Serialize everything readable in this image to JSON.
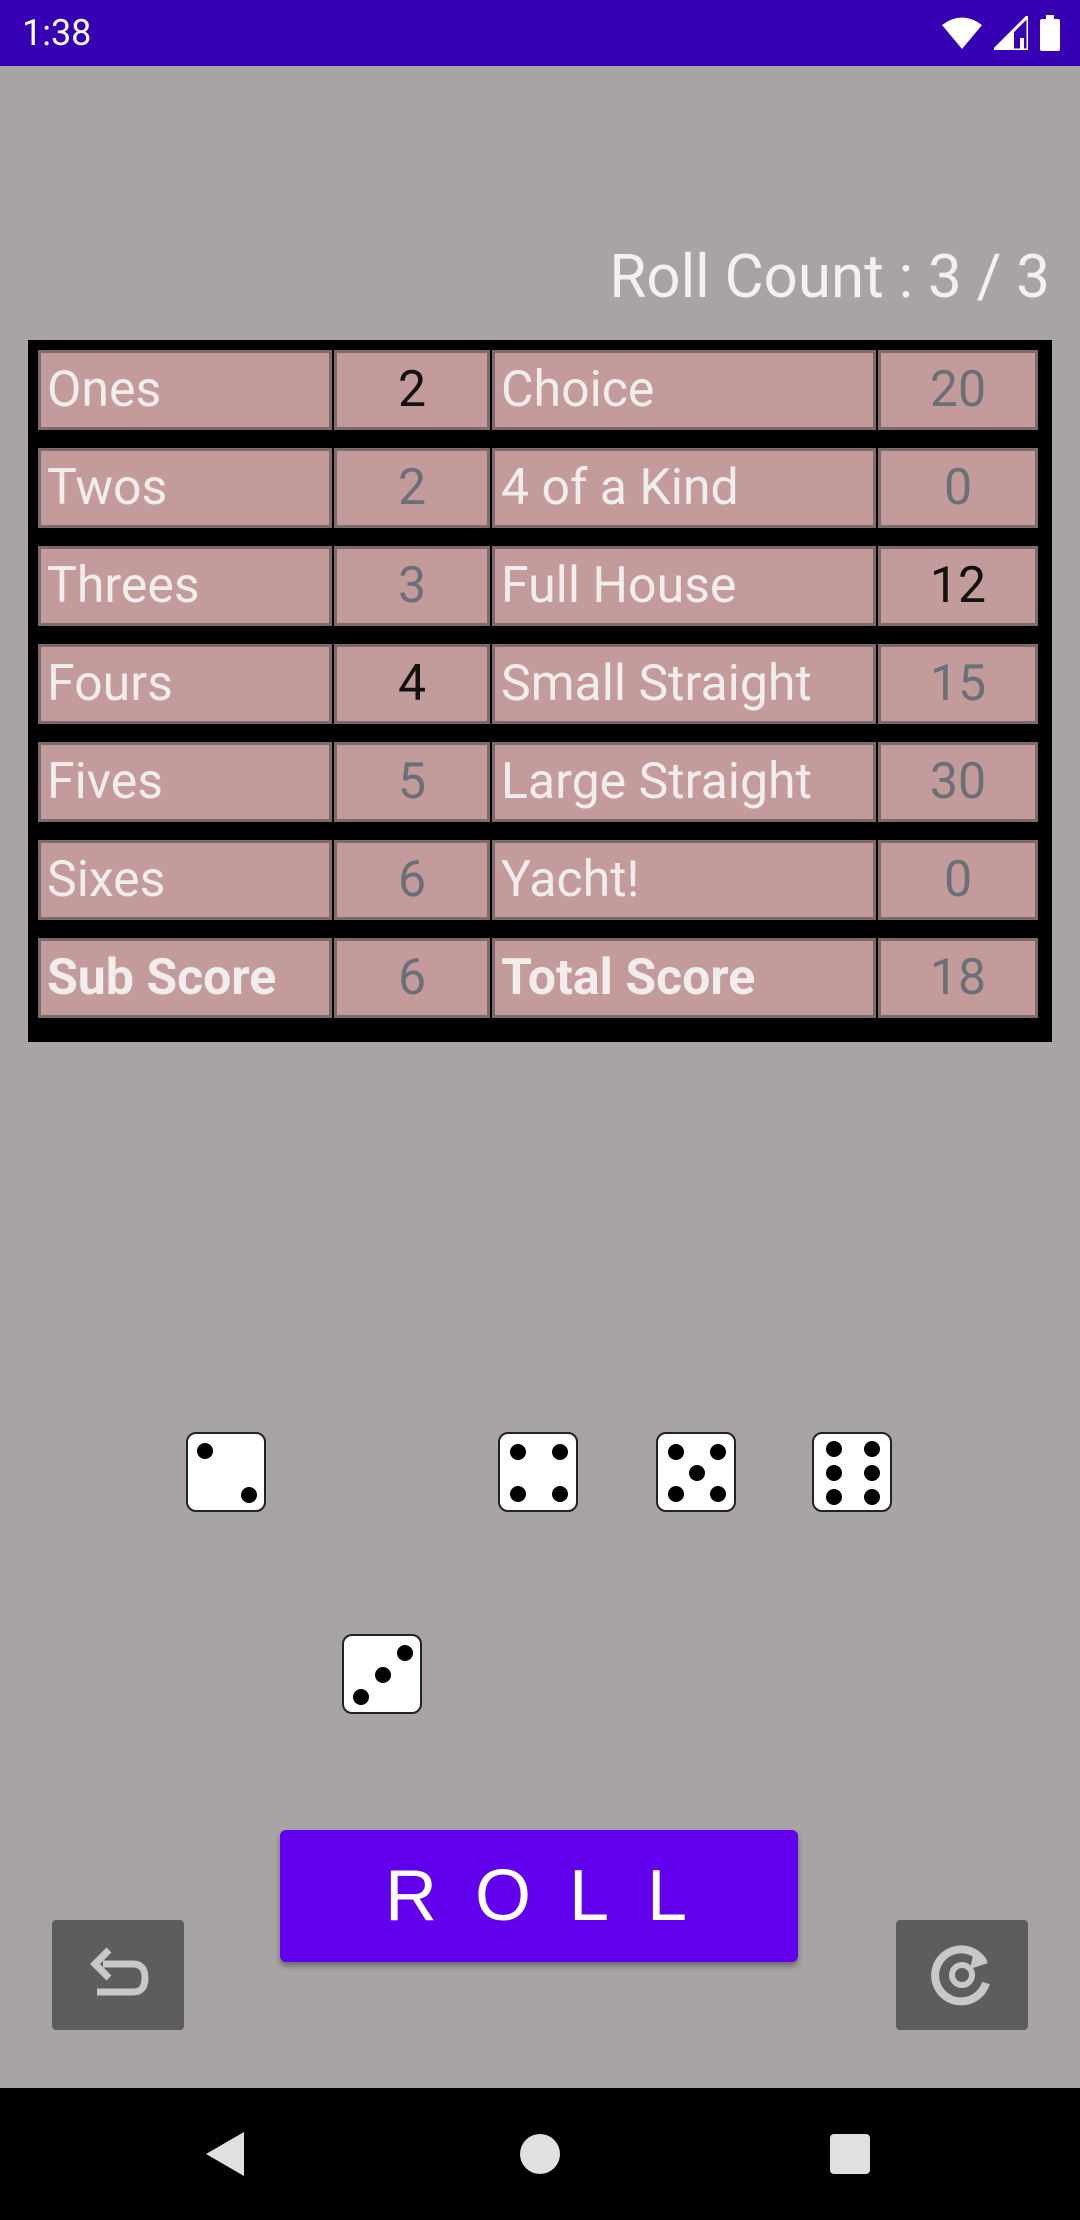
{
  "status_bar": {
    "time": "1:38",
    "icons": [
      "wifi-icon",
      "signal-icon",
      "battery-icon"
    ]
  },
  "roll_count": "Roll Count : 3 / 3",
  "scoreboard": {
    "rows": [
      {
        "left_label": "Ones",
        "left_value": "2",
        "left_confirmed": true,
        "right_label": "Choice",
        "right_value": "20",
        "right_confirmed": false
      },
      {
        "left_label": "Twos",
        "left_value": "2",
        "left_confirmed": false,
        "right_label": "4 of a Kind",
        "right_value": "0",
        "right_confirmed": false
      },
      {
        "left_label": "Threes",
        "left_value": "3",
        "left_confirmed": false,
        "right_label": "Full House",
        "right_value": "12",
        "right_confirmed": true
      },
      {
        "left_label": "Fours",
        "left_value": "4",
        "left_confirmed": true,
        "right_label": "Small Straight",
        "right_value": "15",
        "right_confirmed": false
      },
      {
        "left_label": "Fives",
        "left_value": "5",
        "left_confirmed": false,
        "right_label": "Large Straight",
        "right_value": "30",
        "right_confirmed": false
      },
      {
        "left_label": "Sixes",
        "left_value": "6",
        "left_confirmed": false,
        "right_label": "Yacht!",
        "right_value": "0",
        "right_confirmed": false
      }
    ],
    "totals": {
      "sub_label": "Sub Score",
      "sub_value": "6",
      "total_label": "Total Score",
      "total_value": "18"
    }
  },
  "dice": {
    "unkept": [
      2,
      4,
      5,
      6
    ],
    "kept": [
      3
    ]
  },
  "buttons": {
    "roll_label": "ROLL",
    "undo_icon": "undo-icon",
    "restart_icon": "restart-icon"
  },
  "colors": {
    "status_bar": "#3700b3",
    "background": "#a9a4a4",
    "cell": "#c49b9b",
    "roll_button": "#6200ee",
    "square_button": "#5d5d5d"
  }
}
